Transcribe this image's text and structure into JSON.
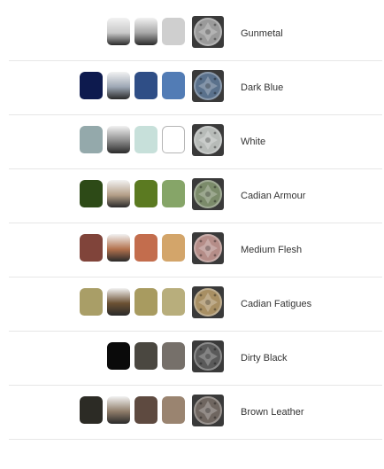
{
  "rows": [
    {
      "name": "Gunmetal",
      "swatches": [
        null,
        "grad:#c9c9c9",
        "grad:#a7a7a7",
        "#cfcfcf"
      ],
      "mini_base": "#9a9a9a"
    },
    {
      "name": "Dark Blue",
      "swatches": [
        "#0d1a4e",
        "grad:#9da7b4",
        "#2f4e86",
        "#527cb5"
      ],
      "mini_base": "#5a718c"
    },
    {
      "name": "White",
      "swatches": [
        "#94a9ab",
        "grad:#8a8a8a",
        "#c7e0da",
        "outline"
      ],
      "mini_base": "#b7bbb8"
    },
    {
      "name": "Cadian Armour",
      "swatches": [
        "#2d4a17",
        "grad:#b49f88",
        "#5b7a21",
        "#86a568"
      ],
      "mini_base": "#7b8b6a"
    },
    {
      "name": "Medium Flesh",
      "swatches": [
        "#80443a",
        "grad:#b3724e",
        "#c36d4d",
        "#d3a56a"
      ],
      "mini_base": "#b58d88"
    },
    {
      "name": "Cadian Fatigues",
      "swatches": [
        "#a99e67",
        "grad:#6c5133",
        "#a89b60",
        "#b8ae7c"
      ],
      "mini_base": "#a88f63"
    },
    {
      "name": "Dirty Black",
      "swatches": [
        null,
        "#0a0a0a",
        "#4a4740",
        "#76706a"
      ],
      "mini_base": "#5a5a5a"
    },
    {
      "name": "Brown Leather",
      "swatches": [
        "#2c2b25",
        "grad:#8f7d6a",
        "#5e4a40",
        "#9a8470"
      ],
      "mini_base": "#6f6660"
    }
  ]
}
